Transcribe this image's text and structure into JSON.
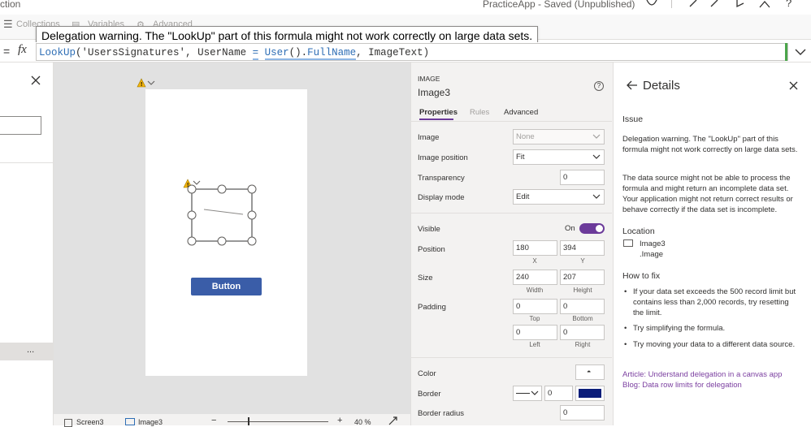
{
  "topbar": {
    "left_fragment": "ction",
    "app_status": "PracticeApp - Saved (Unpublished)",
    "tabs": [
      "Collections",
      "Variables",
      "Advanced"
    ]
  },
  "tooltip": {
    "text": "Delegation warning. The \"LookUp\" part of this formula might not work correctly on large data sets."
  },
  "formula": {
    "property_equals": "=",
    "fx": "fx",
    "tokens": {
      "fn1": "LookUp",
      "p1": "(",
      "str": "'UsersSignatures'",
      "mid": ", UserName ",
      "eq": "=",
      "sp": " ",
      "fn2": "User",
      "p2": "().",
      "fld": "FullName",
      "rest": ", ImageText)"
    }
  },
  "left_panel": {
    "more": "..."
  },
  "canvas": {
    "button_label": "Button"
  },
  "statusbar": {
    "screen_label": "Screen3",
    "image_label": "Image3",
    "minus": "−",
    "plus": "+",
    "zoom": "40 %"
  },
  "properties": {
    "type": "IMAGE",
    "name": "Image3",
    "help": "?",
    "tabs": [
      "Properties",
      "Rules",
      "Advanced"
    ],
    "image_label": "Image",
    "image_value": "None",
    "image_position_label": "Image position",
    "image_position_value": "Fit",
    "transparency_label": "Transparency",
    "transparency_value": "0",
    "display_mode_label": "Display mode",
    "display_mode_value": "Edit",
    "visible_label": "Visible",
    "visible_value": "On",
    "visible_on": true,
    "position_label": "Position",
    "position_x": "180",
    "position_y": "394",
    "x_label": "X",
    "y_label": "Y",
    "size_label": "Size",
    "width_value": "240",
    "height_value": "207",
    "width_label": "Width",
    "height_label": "Height",
    "padding_label": "Padding",
    "padding_top": "0",
    "padding_bottom": "0",
    "padding_left": "0",
    "padding_right": "0",
    "top_label": "Top",
    "bottom_label": "Bottom",
    "left_label": "Left",
    "right_label": "Right",
    "color_label": "Color",
    "border_label": "Border",
    "border_width": "0",
    "border_color": "#0b1d7a",
    "border_radius_label": "Border radius",
    "border_radius_value": "0"
  },
  "details": {
    "title": "Details",
    "issue_label": "Issue",
    "issue_text": "Delegation warning. The \"LookUp\" part of this formula might not work correctly on large data sets.",
    "issue_explain": "The data source might not be able to process the formula and might return an incomplete data set. Your application might not return correct results or behave correctly if the data set is incomplete.",
    "location_label": "Location",
    "location_name": "Image3",
    "location_prop": ".Image",
    "howto_label": "How to fix",
    "fixes": [
      "If your data set exceeds the 500 record limit but contains less than 2,000 records, try resetting the limit.",
      "Try simplifying the formula.",
      "Try moving your data to a different data source."
    ],
    "links": [
      "Article: Understand delegation in a canvas app",
      "Blog: Data row limits for delegation"
    ]
  },
  "colors": {
    "accent_purple": "#6c3b9a",
    "warning": "#f2b30b",
    "button_blue": "#3a5da8",
    "formula_ok": "#4aa54a"
  }
}
